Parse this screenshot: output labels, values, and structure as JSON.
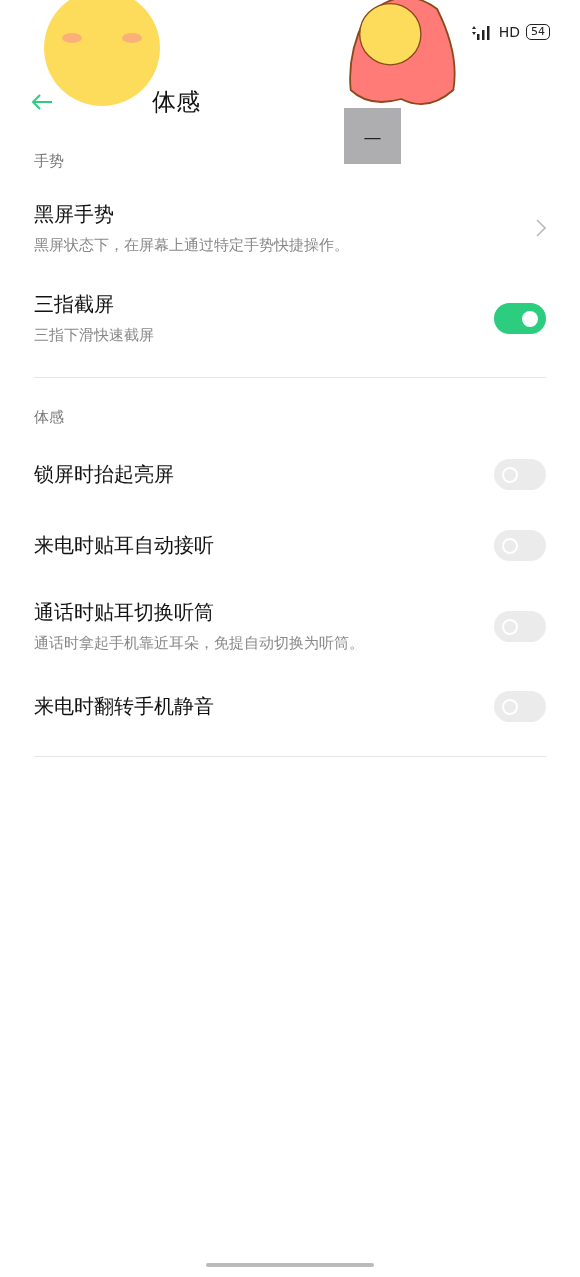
{
  "status_bar": {
    "network": "HD",
    "battery": "54"
  },
  "header": {
    "title": "体感"
  },
  "overlay": {
    "text": "—"
  },
  "sections": [
    {
      "title": "手势",
      "items": [
        {
          "kind": "link",
          "label": "黑屏手势",
          "description": "黑屏状态下，在屏幕上通过特定手势快捷操作。"
        },
        {
          "kind": "toggle",
          "label": "三指截屏",
          "description": "三指下滑快速截屏",
          "on": true
        }
      ]
    },
    {
      "title": "体感",
      "items": [
        {
          "kind": "toggle",
          "label": "锁屏时抬起亮屏",
          "on": false
        },
        {
          "kind": "toggle",
          "label": "来电时贴耳自动接听",
          "on": false
        },
        {
          "kind": "toggle",
          "label": "通话时贴耳切换听筒",
          "description": "通话时拿起手机靠近耳朵，免提自动切换为听筒。",
          "on": false
        },
        {
          "kind": "toggle",
          "label": "来电时翻转手机静音",
          "on": false
        }
      ]
    }
  ]
}
